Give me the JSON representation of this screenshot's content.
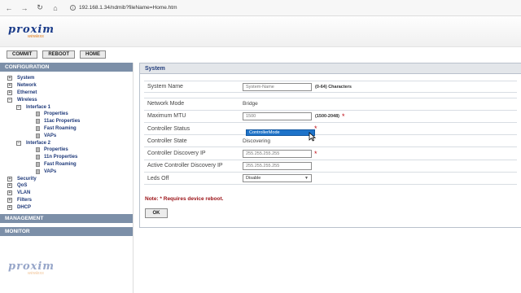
{
  "browser": {
    "url": "192.168.1.34/ndmib?fileName=Home.htm"
  },
  "brand": {
    "name": "proxim",
    "tagline": "wireless"
  },
  "toolbar": {
    "commit_label": "COMMIT",
    "reboot_label": "REBOOT",
    "home_label": "HOME"
  },
  "sidebar": {
    "configuration_header": "CONFIGURATION",
    "items": {
      "system": "System",
      "network": "Network",
      "ethernet": "Ethernet",
      "wireless": "Wireless",
      "interface1": "Interface 1",
      "if1_properties": "Properties",
      "if1_11ac": "11ac Properties",
      "if1_roaming": "Fast Roaming",
      "if1_vaps": "VAPs",
      "interface2": "Interface 2",
      "if2_properties": "Properties",
      "if2_11n": "11n Properties",
      "if2_roaming": "Fast Roaming",
      "if2_vaps": "VAPs",
      "security": "Security",
      "qos": "QoS",
      "vlan": "VLAN",
      "filters": "Filters",
      "dhcp": "DHCP"
    },
    "management_header": "MANAGEMENT",
    "monitor_header": "MONITOR"
  },
  "panel": {
    "title": "System",
    "system_name": {
      "label": "System Name",
      "value": "System-Name",
      "hint": "(0-64) Characters"
    },
    "network_mode": {
      "label": "Network Mode",
      "value": "Bridge"
    },
    "max_mtu": {
      "label": "Maximum MTU",
      "value": "1500",
      "hint": "(1500-2048)",
      "required": "*"
    },
    "controller_status": {
      "label": "Controller Status",
      "required": "*"
    },
    "controller_state": {
      "label": "Controller State",
      "value": "Discovering"
    },
    "controller_discovery_ip": {
      "label": "Controller Discovery IP",
      "value": "255.255.255.255",
      "required": "*"
    },
    "active_controller_ip": {
      "label": "Active Controller Discovery IP",
      "value": "255.255.255.255"
    },
    "leds_off": {
      "label": "Leds Off",
      "value": "Disable"
    },
    "dropdown_option": "ControllerMode",
    "note": "Note: * Requires device reboot.",
    "ok_label": "OK"
  },
  "colors": {
    "section_header": "#7c8fa8",
    "link": "#1f3a7a",
    "required": "#c0101a",
    "selected_option": "#1e73c9"
  }
}
